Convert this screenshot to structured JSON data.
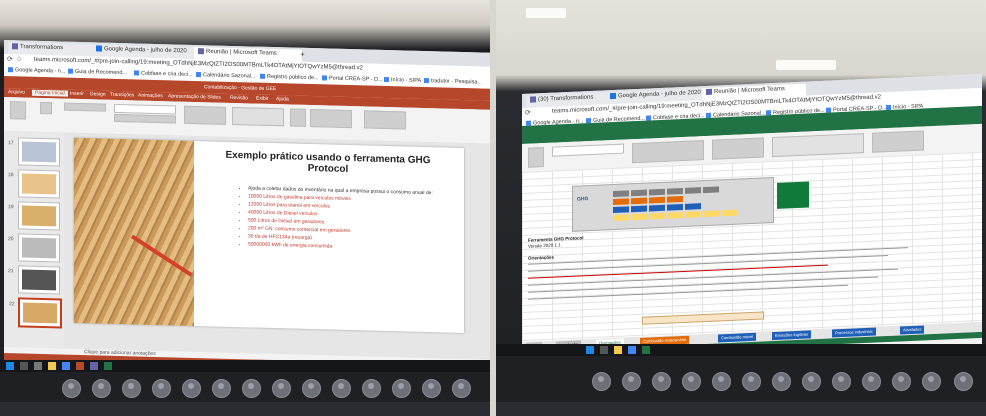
{
  "left": {
    "tabs": [
      {
        "label": "Transformations",
        "active": false
      },
      {
        "label": "Google Agenda - julho de 2020",
        "active": false
      },
      {
        "label": "Reunião | Microsoft Teams",
        "active": true
      }
    ],
    "url": "teams.microsoft.com/_#/pre-join-calling/19:meeting_OTdhNjE3MzQtZTI2OS00MTBmLTk4OTAtMjYtOTQwYzM5@thread.v2",
    "bookmarks": [
      "Google Agenda - n...",
      "Guia de Recomend...",
      "Cobfase e cria deci...",
      "Calendário Sazonal...",
      "Registro público de...",
      "Portal CREA-SP - D...",
      "Início - SIPA",
      "tradutor - Pesquisa..."
    ],
    "ppt": {
      "doc_title": "Contabilização - Gestão de GEE",
      "active_tab": "Página Inicial",
      "tabs": [
        "Arquivo",
        "Página Inicial",
        "Inserir",
        "Design",
        "Transições",
        "Animações",
        "Apresentação de Slides",
        "Revisão",
        "Exibir",
        "Ajuda"
      ],
      "slide_numbers": [
        "17",
        "18",
        "19",
        "20",
        "21",
        "22"
      ],
      "slide_title": "Exemplo prático usando o ferramenta GHG Protocol",
      "bullets": [
        "Ajuda a coletar dados do inventário na qual a empresa possui o consumo anual de:",
        "10000 Litros de gasolina para veículos móveis",
        "12000 Litros para etanol em veículos",
        "40000 Litros de Diesel veículos",
        "500 Litros de Diesel em geradores",
        "200 m³ GN: consumo comercial em geradores",
        "30 t/a de HFC134a (recarga)",
        "50000000 kWh de energia consumida"
      ],
      "notes_placeholder": "Clique para adicionar anotações"
    }
  },
  "right": {
    "tabs": [
      {
        "label": "(30) Transformations",
        "active": false
      },
      {
        "label": "Google Agenda - julho de 2020",
        "active": false
      },
      {
        "label": "Reunião | Microsoft Teams",
        "active": true
      }
    ],
    "excel": {
      "title": "Ferramenta GHG Protocol",
      "subtitle": "Versão 2020.1.1",
      "section": "Orientações",
      "sheet_tabs": [
        "Início",
        "Introdução",
        "Orientações",
        "Combustão estacionária",
        "Combustão móvel",
        "Emissões fugitivas",
        "Processos industriais",
        "Atividades"
      ]
    }
  },
  "colors": {
    "ppt_accent": "#b7472a",
    "excel_accent": "#217346",
    "teams_accent": "#6264a7"
  }
}
